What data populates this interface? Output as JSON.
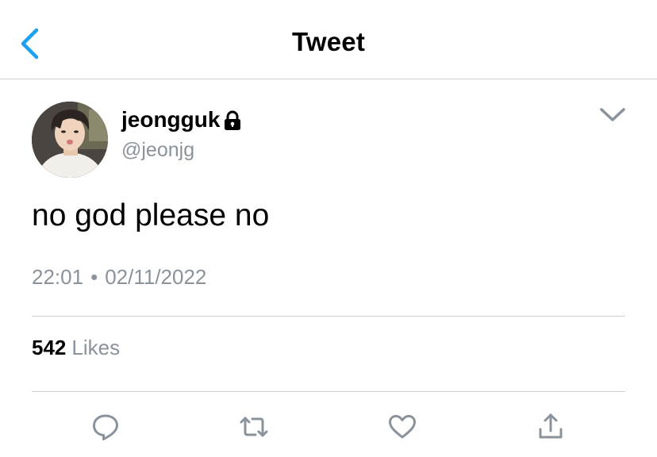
{
  "header": {
    "title": "Tweet"
  },
  "author": {
    "display_name": "jeongguk",
    "handle": "@jeonjg",
    "protected": true
  },
  "tweet": {
    "text": "no god please no",
    "time": "22:01",
    "separator": "•",
    "date": "02/11/2022"
  },
  "stats": {
    "likes_count": "542",
    "likes_label": "Likes"
  },
  "icons": {
    "back": "chevron-left-icon",
    "lock": "lock-icon",
    "more": "chevron-down-icon",
    "reply": "reply-icon",
    "retweet": "retweet-icon",
    "like": "heart-icon",
    "share": "share-icon"
  },
  "colors": {
    "accent": "#1da1f2",
    "secondary_text": "#8a939b",
    "icon": "#8a939b",
    "divider": "#cdd2d6"
  }
}
